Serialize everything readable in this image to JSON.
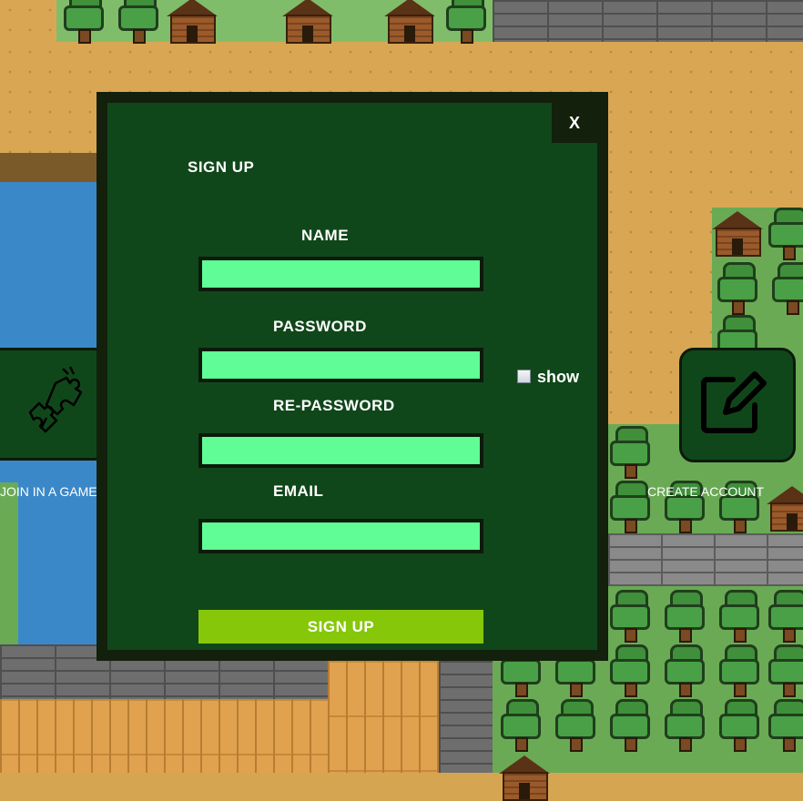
{
  "dialog": {
    "title": "SIGN UP",
    "close_label": "X",
    "fields": {
      "name_label": "NAME",
      "name_value": "",
      "password_label": "PASSWORD",
      "password_value": "",
      "repassword_label": "RE-PASSWORD",
      "repassword_value": "",
      "email_label": "EMAIL",
      "email_value": ""
    },
    "show_label": "show",
    "show_checked": false,
    "submit_label": "SIGN UP"
  },
  "menu": {
    "join_label": "JOIN IN A GAME",
    "join_icon": "puzzle-pieces-icon",
    "create_label": "CREATE ACCOUNT",
    "create_icon": "edit-square-icon"
  },
  "colors": {
    "dialog_bg": "#10471a",
    "field_bg": "#60fd96",
    "submit_bg": "#86c70a",
    "frame": "#12200c"
  }
}
